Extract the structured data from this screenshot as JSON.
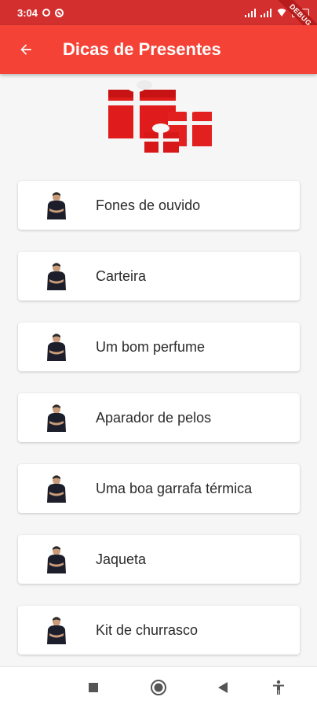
{
  "status_bar": {
    "time": "3:04"
  },
  "debug_banner": {
    "label": "DEBUG"
  },
  "app_bar": {
    "title": "Dicas de Presentes",
    "color": "#f44336"
  },
  "gift_list": {
    "items": [
      {
        "label": "Fones de ouvido"
      },
      {
        "label": "Carteira"
      },
      {
        "label": "Um bom perfume"
      },
      {
        "label": "Aparador de pelos"
      },
      {
        "label": "Uma boa garrafa térmica"
      },
      {
        "label": "Jaqueta"
      },
      {
        "label": "Kit de churrasco"
      }
    ]
  },
  "icons": {
    "back": "arrow-left-icon",
    "hero": "gift-boxes-icon",
    "avatar": "man-avatar-icon",
    "nav": [
      "recents-square-icon",
      "home-circle-icon",
      "back-triangle-icon",
      "accessibility-icon"
    ]
  }
}
